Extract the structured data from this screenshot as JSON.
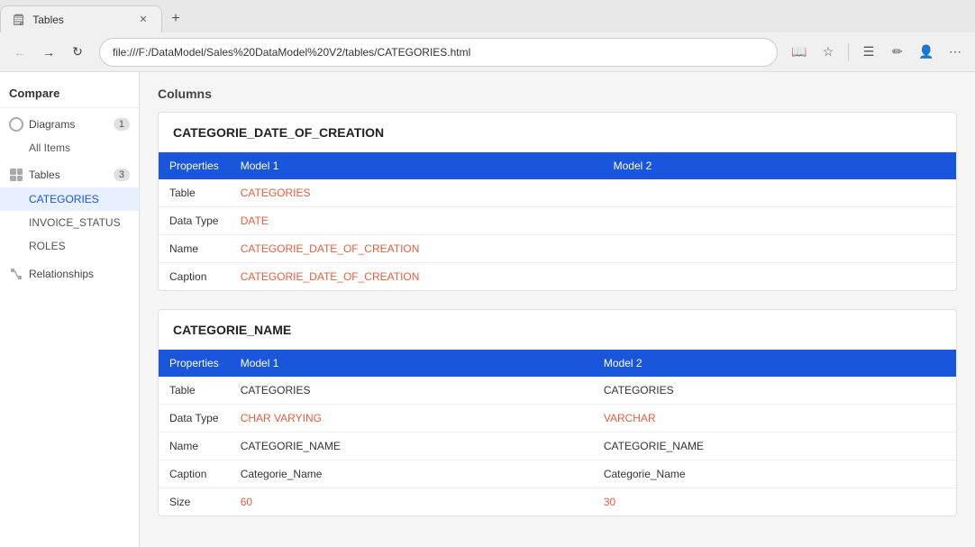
{
  "browser": {
    "tab_title": "Tables",
    "address": "file:///F:/DataModel/Sales%20DataModel%20V2/tables/CATEGORIES.html",
    "new_tab_label": "+"
  },
  "sidebar": {
    "compare_label": "Compare",
    "sections": [
      {
        "id": "diagrams",
        "label": "Diagrams",
        "badge": "1",
        "sub_items": [
          "All Items"
        ]
      },
      {
        "id": "tables",
        "label": "Tables",
        "badge": "3",
        "sub_items": [
          "CATEGORIES",
          "INVOICE_STATUS",
          "ROLES"
        ]
      },
      {
        "id": "relationships",
        "label": "Relationships",
        "badge": ""
      }
    ]
  },
  "main": {
    "columns_label": "Columns",
    "column_sections": [
      {
        "name": "CATEGORIE_DATE_OF_CREATION",
        "table_headers": [
          "Properties",
          "Model 1",
          "Model 2"
        ],
        "rows": [
          {
            "property": "Table",
            "model1": "CATEGORIES",
            "model2": "",
            "model1_color": "red",
            "model2_color": ""
          },
          {
            "property": "Data Type",
            "model1": "DATE",
            "model2": "",
            "model1_color": "red",
            "model2_color": ""
          },
          {
            "property": "Name",
            "model1": "CATEGORIE_DATE_OF_CREATION",
            "model2": "",
            "model1_color": "red",
            "model2_color": ""
          },
          {
            "property": "Caption",
            "model1": "CATEGORIE_DATE_OF_CREATION",
            "model2": "",
            "model1_color": "red",
            "model2_color": ""
          }
        ]
      },
      {
        "name": "CATEGORIE_NAME",
        "table_headers": [
          "Properties",
          "Model 1",
          "Model 2"
        ],
        "rows": [
          {
            "property": "Table",
            "model1": "CATEGORIES",
            "model2": "CATEGORIES",
            "model1_color": "",
            "model2_color": ""
          },
          {
            "property": "Data Type",
            "model1": "CHAR VARYING",
            "model2": "VARCHAR",
            "model1_color": "red",
            "model2_color": "red"
          },
          {
            "property": "Name",
            "model1": "CATEGORIE_NAME",
            "model2": "CATEGORIE_NAME",
            "model1_color": "",
            "model2_color": ""
          },
          {
            "property": "Caption",
            "model1": "Categorie_Name",
            "model2": "Categorie_Name",
            "model1_color": "",
            "model2_color": ""
          },
          {
            "property": "Size",
            "model1": "60",
            "model2": "30",
            "model1_color": "red",
            "model2_color": "red"
          }
        ]
      }
    ]
  },
  "page_title": "CATEGORIES"
}
